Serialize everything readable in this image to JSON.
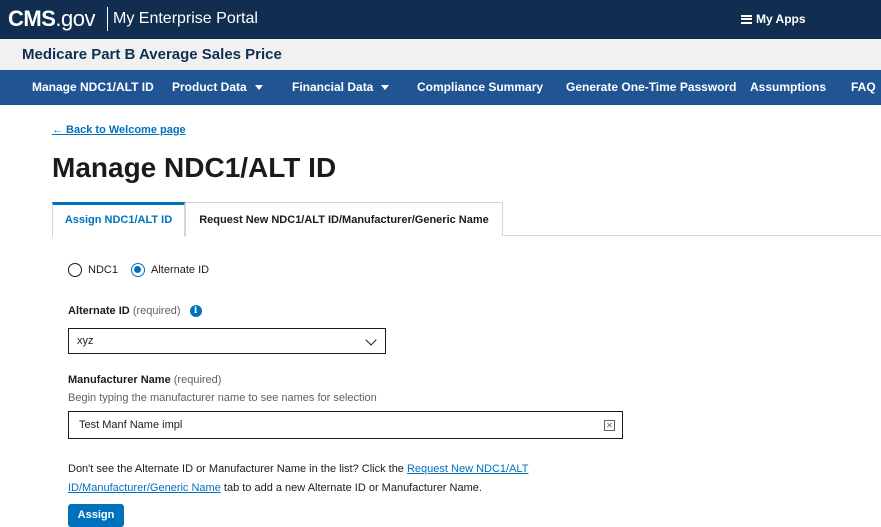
{
  "header": {
    "logo_main": "CMS",
    "logo_suffix": ".gov",
    "portal_name": "My Enterprise Portal",
    "my_apps": "My Apps"
  },
  "app": {
    "title": "Medicare Part B Average Sales Price"
  },
  "nav": {
    "items": [
      {
        "label": "Manage NDC1/ALT ID"
      },
      {
        "label": "Product Data"
      },
      {
        "label": "Financial Data"
      },
      {
        "label": "Compliance Summary"
      },
      {
        "label": "Generate One-Time Password"
      },
      {
        "label": "Assumptions"
      },
      {
        "label": "FAQ"
      }
    ]
  },
  "page": {
    "back_link": "← Back to Welcome page",
    "title": "Manage NDC1/ALT ID"
  },
  "tabs": [
    {
      "label": "Assign NDC1/ALT ID"
    },
    {
      "label": "Request New NDC1/ALT ID/Manufacturer/Generic Name"
    }
  ],
  "form": {
    "radio_ndc1": "NDC1",
    "radio_alt": "Alternate ID",
    "alt_id_label": "Alternate ID",
    "required_text": "(required)",
    "alt_id_value": "xyz",
    "manf_label": "Manufacturer Name",
    "manf_hint": "Begin typing the manufacturer name to see names for selection",
    "manf_value": "Test Manf Name impl",
    "help_before": "Don't see the Alternate ID or Manufacturer Name in the list? Click the ",
    "help_link_1": "Request New NDC1/ALT",
    "help_link_2": "ID/Manufacturer/Generic Name",
    "help_after": " tab to add a new Alternate ID or Manufacturer Name.",
    "assign_label": "Assign"
  },
  "colors": {
    "header_bg": "#112e51",
    "nav_bg": "#205493",
    "accent": "#0071bc"
  }
}
